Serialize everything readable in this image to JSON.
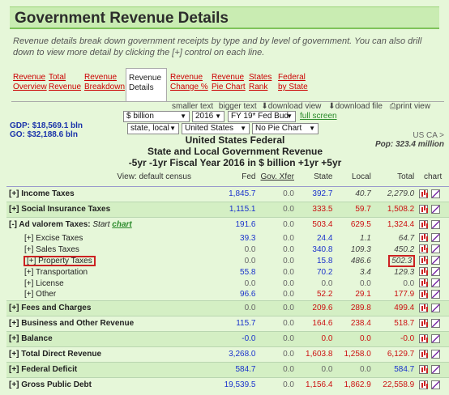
{
  "page": {
    "title": "Government Revenue Details",
    "intro": "Revenue details break down government receipts by type and by level of government. You can also drill down to view more detail by clicking the [+] control on each line."
  },
  "nav": {
    "tabs": [
      {
        "label": "Revenue Overview"
      },
      {
        "label": "Total Revenue"
      },
      {
        "label": "Revenue Breakdown"
      },
      {
        "label": "Revenue Details"
      },
      {
        "label": "Revenue Change %"
      },
      {
        "label": "Revenue Pie Chart"
      },
      {
        "label": "States Rank"
      },
      {
        "label": "Federal by State"
      }
    ]
  },
  "toolbar": {
    "smaller_text": "smaller text",
    "bigger_text": "bigger text",
    "download_view": "download view",
    "download_file": "download file",
    "print_view": "print view",
    "unit": "$ billion",
    "year": "2016",
    "budget": "FY 19* Fed Bud",
    "full_screen": "full screen",
    "level": "state, local",
    "region": "United States",
    "pie": "No Pie Chart"
  },
  "summary": {
    "gdp": "GDP: $18,569.1 bln",
    "go": "GO: $32,188.6 bln",
    "region_code": "US CA >",
    "pop": "Pop: 323.4 million"
  },
  "heading": {
    "line1": "United States Federal",
    "line2": "State and Local Government Revenue",
    "line3": "-5yr -1yr   Fiscal Year 2016 in $ billion   +1yr +5yr"
  },
  "table": {
    "headers": {
      "view": "View: default census",
      "fed": "Fed",
      "gov": "Gov. Xfer",
      "state": "State",
      "local": "Local",
      "total": "Total",
      "chart": "chart"
    },
    "rows": [
      {
        "name": "[+] Income Taxes",
        "fed": "1,845.7",
        "gov": "0.0",
        "state": "392.7",
        "local": "40.7",
        "total": "2,279.0"
      },
      {
        "name": "[+] Social Insurance Taxes",
        "fed": "1,115.1",
        "gov": "0.0",
        "state": "333.5",
        "local": "59.7",
        "total": "1,508.2"
      },
      {
        "name": "[-] Ad valorem Taxes:",
        "start": "Start",
        "start_link": "chart",
        "fed": "191.6",
        "gov": "0.0",
        "state": "503.4",
        "local": "629.5",
        "total": "1,324.4"
      },
      {
        "name": "[+] Excise Taxes",
        "fed": "39.3",
        "gov": "0.0",
        "state": "24.4",
        "local": "1.1",
        "total": "64.7"
      },
      {
        "name": "[+] Sales Taxes",
        "fed": "0.0",
        "gov": "0.0",
        "state": "340.8",
        "local": "109.3",
        "total": "450.2"
      },
      {
        "name": "[+] Property Taxes",
        "fed": "0.0",
        "gov": "0.0",
        "state": "15.8",
        "local": "486.6",
        "total": "502.3"
      },
      {
        "name": "[+] Transportation",
        "fed": "55.8",
        "gov": "0.0",
        "state": "70.2",
        "local": "3.4",
        "total": "129.3"
      },
      {
        "name": "[+] License",
        "fed": "0.0",
        "gov": "0.0",
        "state": "0.0",
        "local": "0.0",
        "total": "0.0"
      },
      {
        "name": "[+] Other",
        "fed": "96.6",
        "gov": "0.0",
        "state": "52.2",
        "local": "29.1",
        "total": "177.9"
      },
      {
        "name": "[+] Fees and Charges",
        "fed": "0.0",
        "gov": "0.0",
        "state": "209.6",
        "local": "289.8",
        "total": "499.4"
      },
      {
        "name": "[+] Business and Other Revenue",
        "fed": "115.7",
        "gov": "0.0",
        "state": "164.6",
        "local": "238.4",
        "total": "518.7"
      },
      {
        "name": "[+] Balance",
        "fed": "-0.0",
        "gov": "0.0",
        "state": "0.0",
        "local": "0.0",
        "total": "-0.0"
      },
      {
        "name": "[+] Total Direct Revenue",
        "fed": "3,268.0",
        "gov": "0.0",
        "state": "1,603.8",
        "local": "1,258.0",
        "total": "6,129.7"
      },
      {
        "name": "[+] Federal Deficit",
        "fed": "584.7",
        "gov": "0.0",
        "state": "0.0",
        "local": "0.0",
        "total": "584.7"
      },
      {
        "name": "[+] Gross Public Debt",
        "fed": "19,539.5",
        "gov": "0.0",
        "state": "1,156.4",
        "local": "1,862.9",
        "total": "22,558.9"
      }
    ]
  },
  "colors": {
    "background": "#e6f7d9",
    "title_band": "#c9ecb2",
    "nav_link": "#cc0000",
    "federal_blue": "#1a33cc",
    "negative_red": "#cc1111",
    "highlight_box": "#cc2222"
  }
}
